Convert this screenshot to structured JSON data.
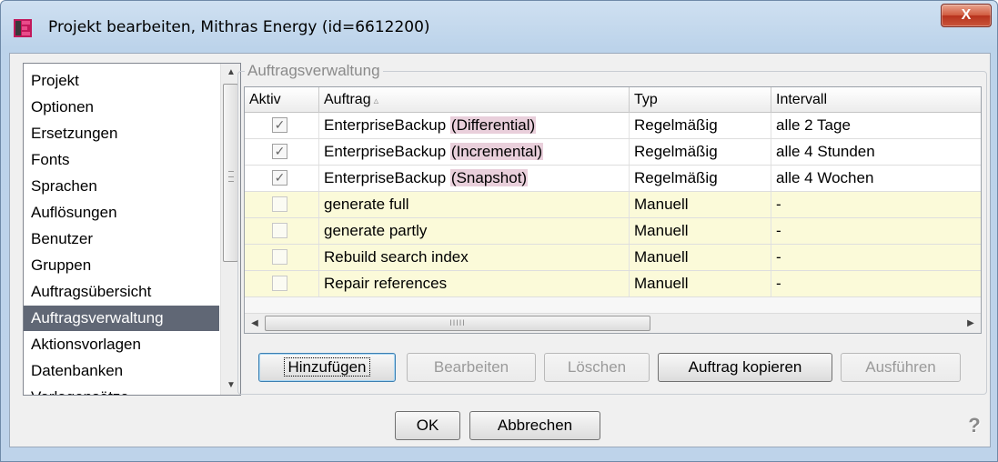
{
  "window": {
    "title": "Projekt bearbeiten, Mithras Energy (id=6612200)",
    "close_glyph": "X"
  },
  "sidebar": {
    "items": [
      {
        "label": "Projekt"
      },
      {
        "label": "Optionen"
      },
      {
        "label": "Ersetzungen"
      },
      {
        "label": "Fonts"
      },
      {
        "label": "Sprachen"
      },
      {
        "label": "Auflösungen"
      },
      {
        "label": "Benutzer"
      },
      {
        "label": "Gruppen"
      },
      {
        "label": "Auftragsübersicht"
      },
      {
        "label": "Auftragsverwaltung",
        "selected": true
      },
      {
        "label": "Aktionsvorlagen"
      },
      {
        "label": "Datenbanken"
      },
      {
        "label": "Vorlagensätze"
      }
    ],
    "selected_index": 9
  },
  "group": {
    "title": "Auftragsverwaltung"
  },
  "table": {
    "columns": [
      {
        "label": "Aktiv"
      },
      {
        "label": "Auftrag",
        "sort_icon": "▵"
      },
      {
        "label": "Typ"
      },
      {
        "label": "Intervall"
      }
    ],
    "rows": [
      {
        "active": true,
        "name": "EnterpriseBackup",
        "variant": "(Differential)",
        "type": "Regelmäßig",
        "interval": "alle 2 Tage"
      },
      {
        "active": true,
        "name": "EnterpriseBackup",
        "variant": "(Incremental)",
        "type": "Regelmäßig",
        "interval": "alle 4 Stunden"
      },
      {
        "active": true,
        "name": "EnterpriseBackup",
        "variant": "(Snapshot)",
        "type": "Regelmäßig",
        "interval": "alle 4 Wochen"
      },
      {
        "active": false,
        "name": "generate full",
        "variant": "",
        "type": "Manuell",
        "interval": "-"
      },
      {
        "active": false,
        "name": "generate partly",
        "variant": "",
        "type": "Manuell",
        "interval": "-"
      },
      {
        "active": false,
        "name": "Rebuild search index",
        "variant": "",
        "type": "Manuell",
        "interval": "-"
      },
      {
        "active": false,
        "name": "Repair references",
        "variant": "",
        "type": "Manuell",
        "interval": "-"
      }
    ]
  },
  "actions": {
    "add": "Hinzufügen",
    "edit": "Bearbeiten",
    "delete": "Löschen",
    "copy": "Auftrag kopieren",
    "run": "Ausführen"
  },
  "footer": {
    "ok": "OK",
    "cancel": "Abbrechen",
    "help": "?"
  },
  "colors": {
    "selection": "#606775",
    "manual_row": "#fbfad9",
    "variant_highlight": "#e9cfdb"
  },
  "icons": {
    "app": "app-logo-icon",
    "check": "✓",
    "scroll_up": "▲",
    "scroll_down": "▼",
    "scroll_left": "◀",
    "scroll_right": "▶",
    "hgrip": "IIIII"
  }
}
